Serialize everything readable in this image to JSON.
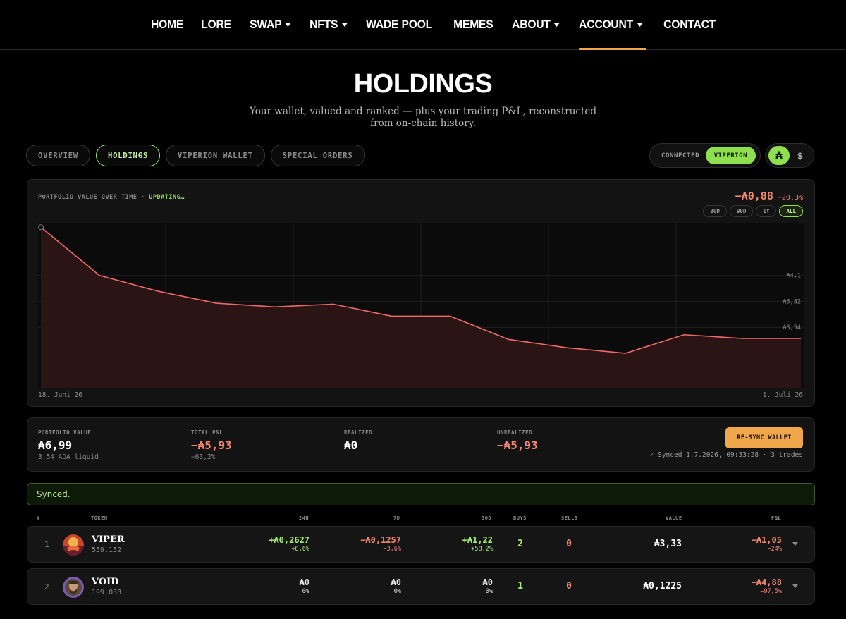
{
  "nav": {
    "items": [
      {
        "label": "HOME",
        "caret": false
      },
      {
        "label": "LORE",
        "caret": false
      },
      {
        "label": "SWAP",
        "caret": true
      },
      {
        "label": "NFTS",
        "caret": true
      },
      {
        "label": "WADE POOL",
        "caret": false
      },
      {
        "label": "MEMES",
        "caret": false
      },
      {
        "label": "ABOUT",
        "caret": true
      },
      {
        "label": "ACCOUNT",
        "caret": true,
        "active": true
      },
      {
        "label": "CONTACT",
        "caret": false
      }
    ]
  },
  "header": {
    "title": "HOLDINGS",
    "subtitle": "Your wallet, valued and ranked — plus your trading P&L, reconstructed from on-chain history."
  },
  "tabs": [
    {
      "label": "OVERVIEW",
      "active": false
    },
    {
      "label": "HOLDINGS",
      "active": true
    },
    {
      "label": "VIPERION WALLET",
      "active": false
    },
    {
      "label": "SPECIAL ORDERS",
      "active": false
    }
  ],
  "connection": {
    "status": "CONNECTED",
    "wallet": "VIPERION"
  },
  "currency": {
    "ada": "₳",
    "usd": "$"
  },
  "chart_card": {
    "label": "PORTFOLIO VALUE OVER TIME · ",
    "updating": "UPDATING…",
    "delta_value": "−₳0,88",
    "delta_pct": "−20,3%",
    "ranges": [
      {
        "label": "30D",
        "active": false
      },
      {
        "label": "90D",
        "active": false
      },
      {
        "label": "1Y",
        "active": false
      },
      {
        "label": "ALL",
        "active": true
      }
    ],
    "x_start": "18. Juni 26",
    "x_end": "1. Juli 26"
  },
  "chart_data": {
    "type": "area",
    "y_ticks": [
      {
        "value": 4.1,
        "label": "₳4,1"
      },
      {
        "value": 3.82,
        "label": "₳3,82"
      },
      {
        "value": 3.54,
        "label": "₳3,54"
      }
    ],
    "ylim": [
      2.88,
      4.66
    ],
    "x_labels": [
      "18. Juni 26",
      "1. Juli 26"
    ],
    "values": [
      4.62,
      4.1,
      3.93,
      3.8,
      3.76,
      3.79,
      3.66,
      3.66,
      3.41,
      3.32,
      3.26,
      3.46,
      3.42,
      3.42
    ],
    "line_color": "#f06a6a",
    "fill_color": "#2a1414",
    "grid": true
  },
  "stats": {
    "portfolio_label": "PORTFOLIO VALUE",
    "portfolio_value": "₳6,99",
    "portfolio_sub": "3,54 ADA liquid",
    "pnl_label": "TOTAL P&L",
    "pnl_value": "−₳5,93",
    "pnl_sub": "−63,2%",
    "realized_label": "REALIZED",
    "realized_value": "₳0",
    "unrealized_label": "UNREALIZED",
    "unrealized_value": "−₳5,93",
    "resync_label": "RE-SYNC WALLET",
    "synced_info": "✓ Synced 1.7.2026, 09:33:28 · 3 trades"
  },
  "banner": {
    "text": "Synced."
  },
  "table": {
    "headers": {
      "rank": "#",
      "token": "TOKEN",
      "h24": "24H",
      "d7": "7D",
      "d30": "30D",
      "buys": "BUYS",
      "sells": "SELLS",
      "value": "VALUE",
      "pnl": "P&L"
    },
    "rows": [
      {
        "rank": "1",
        "name": "VIPER",
        "amount": "559.152",
        "h24": "+₳0,2627",
        "h24_pct": "+8,6%",
        "d7": "−₳0,1257",
        "d7_pct": "−3,6%",
        "d30": "+₳1,22",
        "d30_pct": "+58,2%",
        "buys": "2",
        "sells": "0",
        "value": "₳3,33",
        "pnl": "−₳1,05",
        "pnl_pct": "−24%"
      },
      {
        "rank": "2",
        "name": "VOID",
        "amount": "199.083",
        "h24": "₳0",
        "h24_pct": "0%",
        "d7": "₳0",
        "d7_pct": "0%",
        "d30": "₳0",
        "d30_pct": "0%",
        "buys": "1",
        "sells": "0",
        "value": "₳0,1225",
        "pnl": "−₳4,88",
        "pnl_pct": "−97,5%"
      }
    ]
  },
  "colors": {
    "accent_orange": "#f0a64a",
    "accent_green": "#8ee04f",
    "negative": "#f2866f",
    "positive": "#a5ec72"
  }
}
